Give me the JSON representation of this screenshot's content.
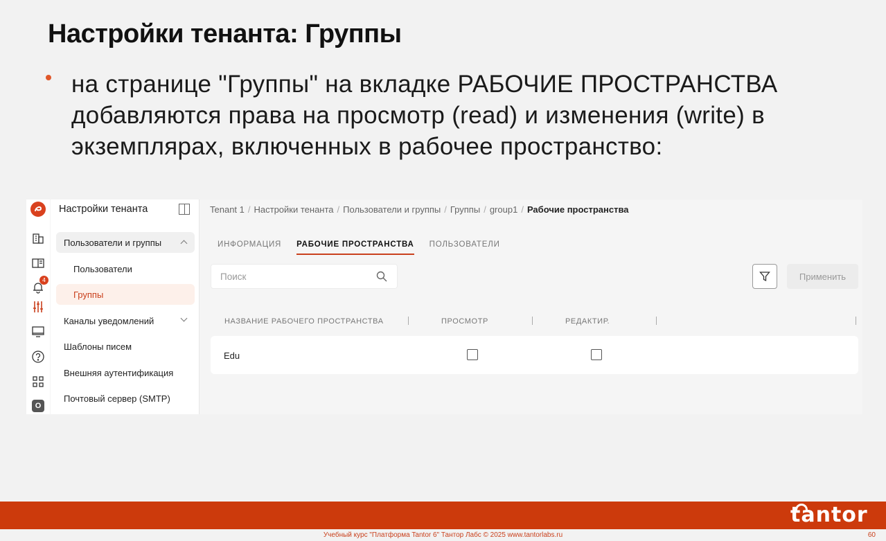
{
  "slide": {
    "title": "Настройки тенанта: Группы",
    "bullet": "на странице \"Группы\" на вкладке РАБОЧИЕ ПРОСТРАНСТВА добавляются права на просмотр (read) и изменения (write) в экземплярах, включенных в рабочее пространство:"
  },
  "rail": {
    "icons": [
      "tantor-logo-icon",
      "building-icon",
      "book-icon",
      "bell-icon",
      "settings-sliders-icon",
      "monitor-icon",
      "help-icon",
      "grid-icon"
    ],
    "notifications_badge": "4",
    "bottom_button": "O"
  },
  "sidebar": {
    "title": "Настройки тенанта",
    "items": [
      {
        "label": "Пользователи и группы"
      },
      {
        "label": "Пользователи"
      },
      {
        "label": "Группы"
      },
      {
        "label": "Каналы уведомлений"
      },
      {
        "label": "Шаблоны писем"
      },
      {
        "label": "Внешняя аутентификация"
      },
      {
        "label": "Почтовый сервер (SMTP)"
      }
    ]
  },
  "breadcrumbs": {
    "items": [
      "Tenant 1",
      "Настройки тенанта",
      "Пользователи и группы",
      "Группы",
      "group1"
    ],
    "current": "Рабочие пространства"
  },
  "tabs": [
    {
      "label": "ИНФОРМАЦИЯ"
    },
    {
      "label": "РАБОЧИЕ ПРОСТРАНСТВА"
    },
    {
      "label": "ПОЛЬЗОВАТЕЛИ"
    }
  ],
  "search": {
    "placeholder": "Поиск"
  },
  "apply_label": "Применить",
  "table": {
    "columns": [
      "НАЗВАНИЕ РАБОЧЕГО ПРОСТРАНСТВА",
      "ПРОСМОТР",
      "РЕДАКТИР."
    ],
    "rows": [
      {
        "name": "Edu",
        "read": false,
        "write": false
      }
    ]
  },
  "footer": {
    "brand": "tantor",
    "text": "Учебный курс \"Платформа Tantor 6\" Тантор Лабс © 2025  www.tantorlabs.ru",
    "page": "60"
  },
  "colors": {
    "accent": "#cc3a0c",
    "active_tab_underline": "#c9401c"
  }
}
